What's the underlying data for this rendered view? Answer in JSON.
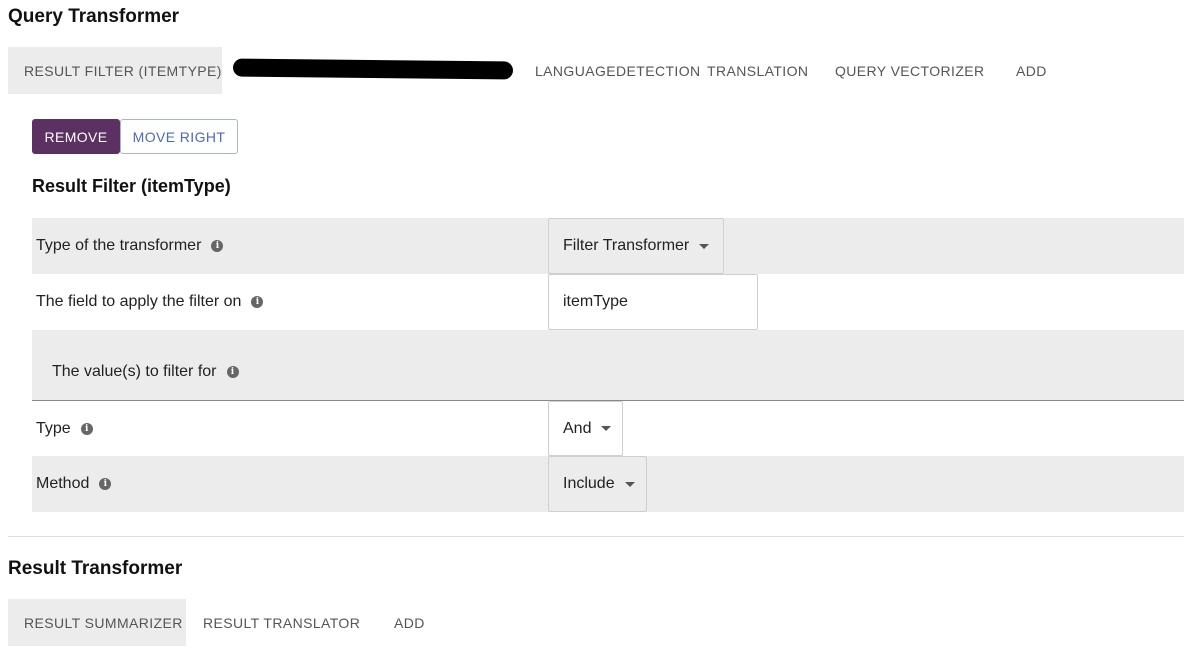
{
  "query_transformer": {
    "title": "Query Transformer",
    "tabs": [
      {
        "label": "RESULT FILTER (ITEMTYPE)",
        "active": true
      },
      {
        "label": "",
        "redacted": true
      },
      {
        "label": "LANGUAGEDETECTION"
      },
      {
        "label": "TRANSLATION"
      },
      {
        "label": "QUERY VECTORIZER"
      },
      {
        "label": "ADD"
      }
    ],
    "buttons": {
      "remove": "REMOVE",
      "move_right": "MOVE RIGHT"
    },
    "panel": {
      "title": "Result Filter (itemType)",
      "rows": {
        "type_of_transformer": {
          "label": "Type of the transformer",
          "value": "Filter Transformer"
        },
        "field": {
          "label": "The field to apply the filter on",
          "value": "itemType"
        },
        "values": {
          "label": "The value(s) to filter for"
        },
        "type": {
          "label": "Type",
          "value": "And"
        },
        "method": {
          "label": "Method",
          "value": "Include"
        }
      }
    }
  },
  "result_transformer": {
    "title": "Result Transformer",
    "tabs": [
      {
        "label": "RESULT SUMMARIZER",
        "active": true
      },
      {
        "label": "RESULT TRANSLATOR"
      },
      {
        "label": "ADD"
      }
    ]
  },
  "icons": {
    "info": "info-icon",
    "dropdown": "caret-down-icon"
  },
  "colors": {
    "primary_button": "#5a3161",
    "outline_button_text": "#4a6bb5",
    "shaded_row": "#ececec",
    "active_tab": "#ececec"
  }
}
